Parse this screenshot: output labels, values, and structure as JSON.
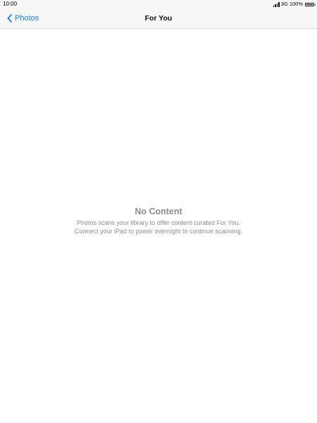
{
  "status_bar": {
    "time": "10:00",
    "network": "3G",
    "battery_text": "100%",
    "battery_level": 1.0
  },
  "nav": {
    "back_label": "Photos",
    "title": "For You"
  },
  "empty_state": {
    "title": "No Content",
    "message": "Photos scans your library to offer content curated For You. Connect your iPad to power overnight to continue scanning."
  },
  "colors": {
    "accent": "#1a7ef5",
    "muted_text": "#8e8e93",
    "bar_background": "#f7f7f7"
  }
}
